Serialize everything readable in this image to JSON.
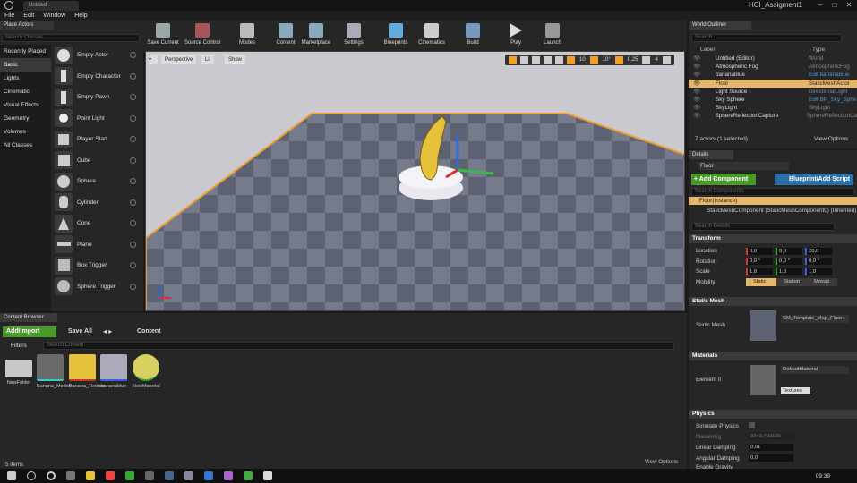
{
  "window": {
    "tab": "Untitled",
    "project": "HCI_Assigment1"
  },
  "menu": [
    "File",
    "Edit",
    "Window",
    "Help"
  ],
  "place": {
    "tab": "Place Actors",
    "search": "Search Classes",
    "categories": [
      "Recently Placed",
      "Basic",
      "Lights",
      "Cinematic",
      "Visual Effects",
      "Geometry",
      "Volumes",
      "All Classes"
    ],
    "assets": [
      "Empty Actor",
      "Empty Character",
      "Empty Pawn",
      "Point Light",
      "Player Start",
      "Cube",
      "Sphere",
      "Cylinder",
      "Cone",
      "Plane",
      "Box Trigger",
      "Sphere Trigger"
    ]
  },
  "toolbar": [
    "Save Current",
    "Source Control",
    "Modes",
    "Content",
    "Marketplace",
    "Settings",
    "Blueprints",
    "Cinematics",
    "Build",
    "Play",
    "Launch"
  ],
  "viewport": {
    "perspective": "Perspective",
    "lit": "Lit",
    "show": "Show",
    "grid": "10",
    "angle": "10°",
    "scale": "0,25",
    "cams": "4"
  },
  "outliner": {
    "tab": "World Outliner",
    "search": "Search...",
    "col_label": "Label",
    "col_type": "Type",
    "rows": [
      {
        "label": "Untitled (Editor)",
        "type": "World"
      },
      {
        "label": "Atmospheric Fog",
        "type": "AtmosphericFog"
      },
      {
        "label": "bananablue",
        "type": "Edit bananablue"
      },
      {
        "label": "Floor",
        "type": "StaticMeshActor"
      },
      {
        "label": "Light Source",
        "type": "DirectionalLight"
      },
      {
        "label": "Sky Sphere",
        "type": "Edit BP_Sky_Sphe"
      },
      {
        "label": "SkyLight",
        "type": "SkyLight"
      },
      {
        "label": "SphereReflectionCapture",
        "type": "SphereReflectionCa"
      }
    ],
    "footer": "7 actors (1 selected)",
    "view_options": "View Options"
  },
  "details": {
    "tab": "Details",
    "name": "Floor",
    "add_component": "+ Add Component",
    "blueprint": "Blueprint/Add Script",
    "search_components": "Search Components",
    "instance": "Floor(Instance)",
    "component": "StaticMeshComponent (StaticMeshComponent0) (Inherited)",
    "search_details": "Search Details",
    "transform": "Transform",
    "location_label": "Location",
    "location": [
      "0,0",
      "0,0",
      "20,0"
    ],
    "rotation_label": "Rotation",
    "rotation": [
      "0,0 °",
      "0,0 °",
      "0,0 °"
    ],
    "scale_label": "Scale",
    "scale": [
      "1,0",
      "1,0",
      "1,0"
    ],
    "mobility_label": "Mobility",
    "mobility": [
      "Static",
      "Station",
      "Movab"
    ],
    "static_mesh_hdr": "Static Mesh",
    "static_mesh_label": "Static Mesh",
    "static_mesh": "SM_Template_Map_Floor",
    "materials_hdr": "Materials",
    "element_label": "Element 0",
    "material": "DefaultMaterial",
    "textures": "Textures",
    "physics_hdr": "Physics",
    "simulate": "Simulate Physics",
    "mass": "MassInKg",
    "mass_val": "3343,703125",
    "lin_damp": "Linear Damping",
    "lin_val": "0,01",
    "ang_damp": "Angular Damping",
    "ang_val": "0,0",
    "gravity": "Enable Gravity"
  },
  "content": {
    "tab": "Content Browser",
    "add": "Add/Import",
    "save": "Save All",
    "path": "Content",
    "filters": "Filters",
    "search": "Search Content",
    "items": [
      "NewFolder",
      "Banana_Model",
      "Banana_Texture",
      "bananablue",
      "NewMaterial"
    ],
    "count": "5 items",
    "view_options": "View Options"
  },
  "taskbar": {
    "time": "09:39"
  },
  "colors": {
    "accent": "#f0a030",
    "select": "#2d6fa8",
    "green": "#4a9a2a"
  }
}
